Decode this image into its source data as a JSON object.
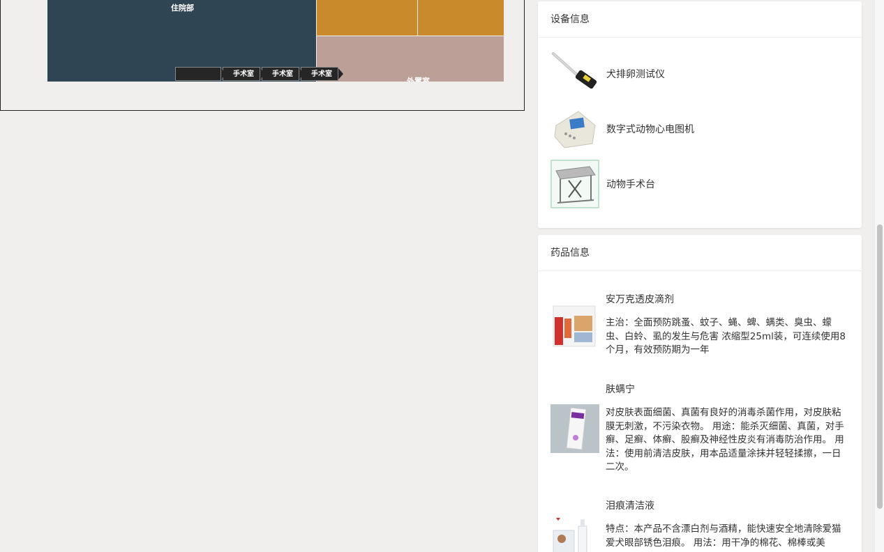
{
  "treemap": {
    "inpatient_label": "住院部",
    "outpatient_label": "外置室",
    "breadcrumbs": [
      "",
      "手术室",
      "手术室",
      "手术室"
    ],
    "colors": {
      "inpatient": "#304553",
      "surgery": "#c98a2c",
      "outpatient": "#bca098"
    }
  },
  "equipment": {
    "title": "设备信息",
    "items": [
      {
        "name": "犬排卵测试仪",
        "icon": "ovulation-tester-image"
      },
      {
        "name": "数字式动物心电图机",
        "icon": "ecg-machine-image"
      },
      {
        "name": "动物手术台",
        "icon": "surgery-table-image"
      }
    ]
  },
  "drugs": {
    "title": "药品信息",
    "items": [
      {
        "name": "安万克透皮滴剂",
        "desc": "主治：全面预防跳蚤、蚊子、蝇、蜱、螨类、臭虫、蠓虫、白蛉、虱的发生与危害 浓缩型25ml装，可连续使用8个月，有效预防期为一年",
        "icon": "advantix-box-image"
      },
      {
        "name": "肤螨宁",
        "desc": "对皮肤表面细菌、真菌有良好的消毒杀菌作用，对皮肤粘膜无刺激，不污染衣物。 用途：能杀灭细菌、真菌，对手癣、足癣、体癣、股癣及神经性皮炎有消毒防治作用。 用法：使用前清洁皮肤，用本品适量涂抹并轻轻揉擦，一日二次。",
        "icon": "spray-box-image"
      },
      {
        "name": "泪痕清洁液",
        "desc": "特点：本产品不含漂白剂与酒精，能快速安全地清除爱猫爱犬眼部锈色泪痕。 用法：用干净的棉花、棉棒或美",
        "icon": "tear-cleaner-image"
      }
    ]
  }
}
